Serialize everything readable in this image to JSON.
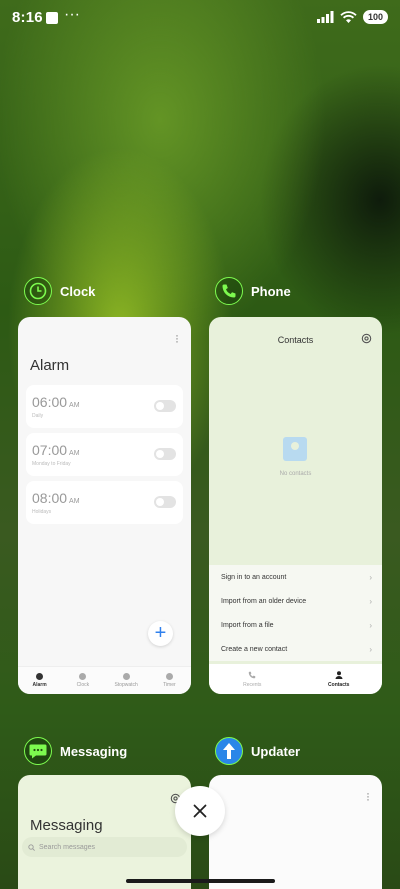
{
  "status_bar": {
    "time": "8:16",
    "dots": "···",
    "battery": "100"
  },
  "cards": {
    "clock": {
      "app_name": "Clock",
      "title": "Alarm",
      "alarms": [
        {
          "time": "06:00",
          "ampm": "AM",
          "sub": "Daily"
        },
        {
          "time": "07:00",
          "ampm": "AM",
          "sub": "Monday to Friday"
        },
        {
          "time": "08:00",
          "ampm": "AM",
          "sub": "Holidays"
        }
      ],
      "fab": "+",
      "tabs": [
        "Alarm",
        "Clock",
        "Stopwatch",
        "Timer"
      ]
    },
    "phone": {
      "app_name": "Phone",
      "title": "Contacts",
      "empty_text": "No contacts",
      "options": [
        "Sign in to an account",
        "Import from an older device",
        "Import from a file",
        "Create a new contact"
      ],
      "tabs": [
        "Recents",
        "Contacts"
      ]
    },
    "messaging": {
      "app_name": "Messaging",
      "title": "Messaging",
      "search_placeholder": "Search messages"
    },
    "updater": {
      "app_name": "Updater"
    }
  },
  "colors": {
    "accent_green": "#7dfb4f",
    "blue": "#2f80ed"
  }
}
